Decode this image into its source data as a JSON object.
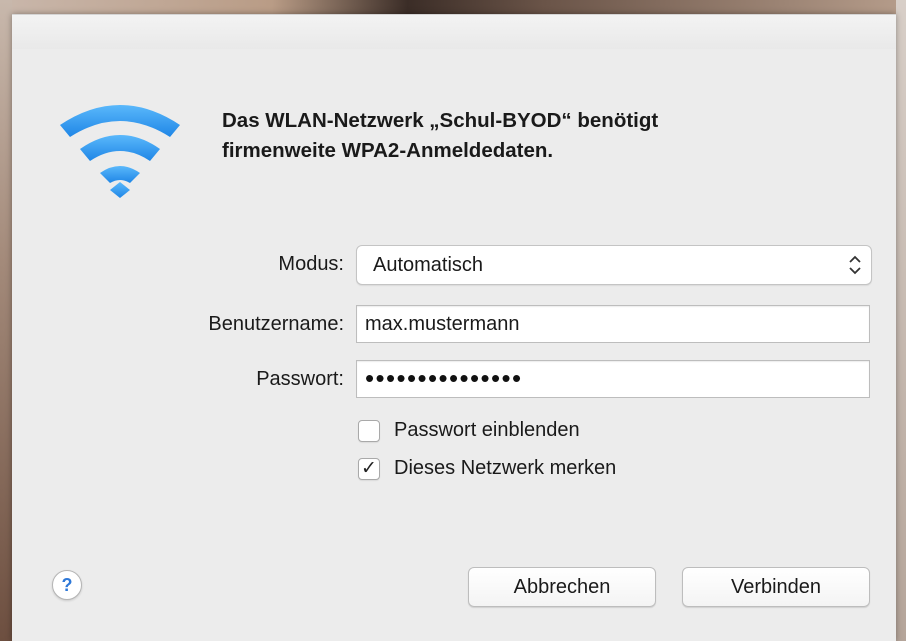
{
  "dialog": {
    "headline_line1": "Das WLAN-Netzwerk „Schul-BYOD“ benötigt",
    "headline_line2": "firmenweite WPA2-Anmeldedaten.",
    "icon": "wifi-icon"
  },
  "form": {
    "mode": {
      "label": "Modus:",
      "value": "Automatisch"
    },
    "username": {
      "label": "Benutzername:",
      "value": "max.mustermann"
    },
    "password": {
      "label": "Passwort:",
      "masked_value": "•••••••••••••••"
    },
    "show_password": {
      "label": "Passwort einblenden",
      "checked": false
    },
    "remember_network": {
      "label": "Dieses Netzwerk merken",
      "checked": true,
      "mark": "✓"
    }
  },
  "buttons": {
    "help": "?",
    "cancel": "Abbrechen",
    "connect": "Verbinden"
  },
  "colors": {
    "wifi_blue": "#2e9cf0",
    "dialog_bg": "#ececec"
  }
}
